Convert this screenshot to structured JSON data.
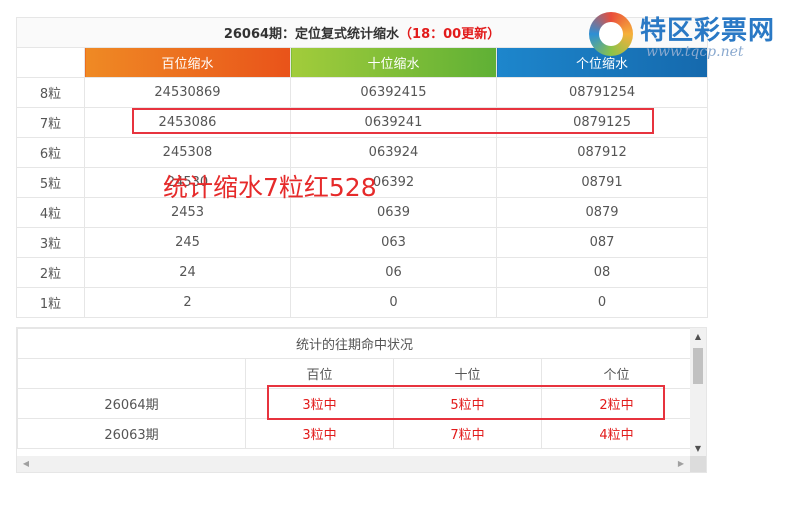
{
  "main": {
    "title": "26064期：定位复式统计缩水",
    "title_highlight": "（18：00更新）",
    "headers": [
      "百位缩水",
      "十位缩水",
      "个位缩水"
    ],
    "rows": [
      {
        "label": "8粒",
        "values": [
          "24530869",
          "06392415",
          "08791254"
        ]
      },
      {
        "label": "7粒",
        "values": [
          "2453086",
          "0639241",
          "0879125"
        ]
      },
      {
        "label": "6粒",
        "values": [
          "245308",
          "063924",
          "087912"
        ]
      },
      {
        "label": "5粒",
        "values": [
          "24530",
          "06392",
          "08791"
        ]
      },
      {
        "label": "4粒",
        "values": [
          "2453",
          "0639",
          "0879"
        ]
      },
      {
        "label": "3粒",
        "values": [
          "245",
          "063",
          "087"
        ]
      },
      {
        "label": "2粒",
        "values": [
          "24",
          "06",
          "08"
        ]
      },
      {
        "label": "1粒",
        "values": [
          "2",
          "0",
          "0"
        ]
      }
    ]
  },
  "overlay_text": "统计缩水7粒红528",
  "logo": {
    "brand": "特区彩票网",
    "url": "www.tqcp.net"
  },
  "history": {
    "title": "统计的往期命中状况",
    "headers": [
      "百位",
      "十位",
      "个位"
    ],
    "rows": [
      {
        "period": "26064期",
        "values": [
          "3粒中",
          "5粒中",
          "2粒中"
        ]
      },
      {
        "period": "26063期",
        "values": [
          "3粒中",
          "7粒中",
          "4粒中"
        ]
      }
    ]
  },
  "colors": {
    "accent_red": "#e21b1b",
    "box_red": "#e7333e",
    "brand_blue": "#2a79c5"
  }
}
